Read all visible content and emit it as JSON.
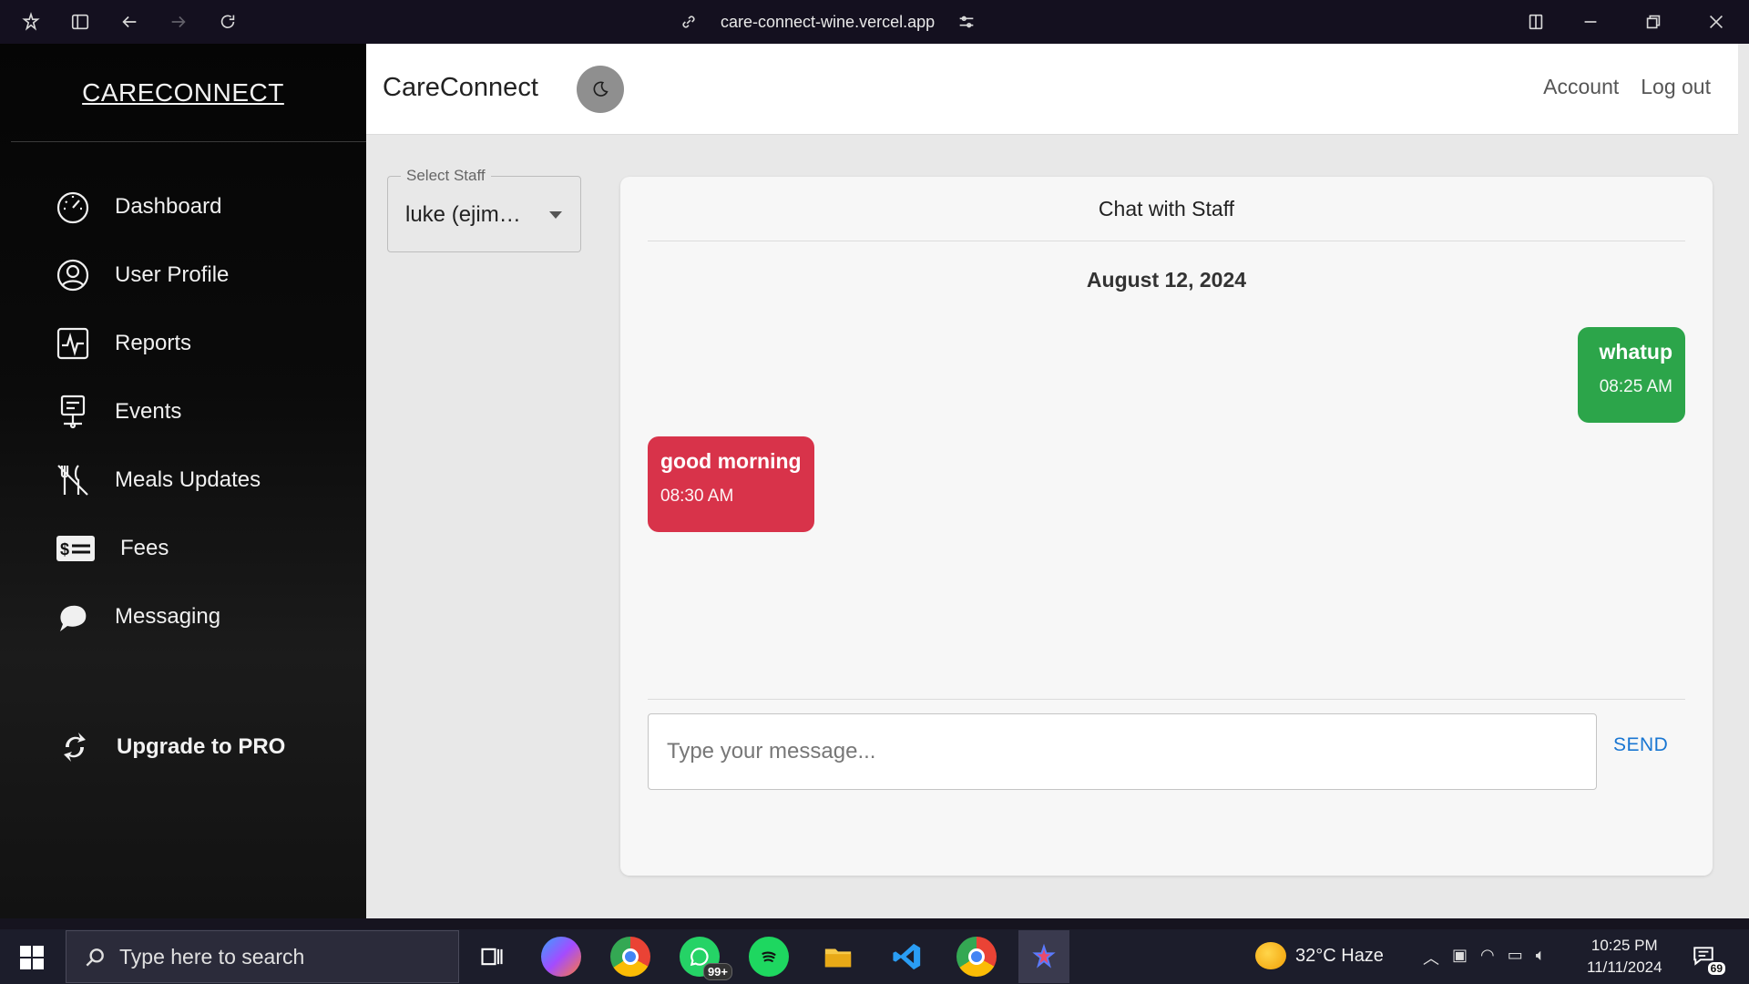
{
  "browser": {
    "url": "care-connect-wine.vercel.app"
  },
  "sidebar": {
    "brand": "CARECONNECT",
    "items": [
      {
        "label": "Dashboard",
        "icon": "dashboard-gauge-icon"
      },
      {
        "label": "User Profile",
        "icon": "user-circle-icon"
      },
      {
        "label": "Reports",
        "icon": "pulse-chart-icon"
      },
      {
        "label": "Events",
        "icon": "presentation-board-icon"
      },
      {
        "label": "Meals Updates",
        "icon": "no-meals-icon"
      },
      {
        "label": "Fees",
        "icon": "money-bill-icon"
      },
      {
        "label": "Messaging",
        "icon": "chat-bubbles-icon"
      }
    ],
    "upgrade": "Upgrade to PRO"
  },
  "header": {
    "title": "CareConnect",
    "account": "Account",
    "logout": "Log out"
  },
  "staff_select": {
    "label": "Select Staff",
    "value": "luke (ejim…"
  },
  "chat": {
    "title": "Chat with Staff",
    "date": "August 12, 2024",
    "messages": [
      {
        "text": "whatup",
        "time": "08:25 AM",
        "direction": "sent",
        "color": "#2ca54a"
      },
      {
        "text": "good morning",
        "time": "08:30 AM",
        "direction": "received",
        "color": "#d8334a"
      }
    ],
    "input_placeholder": "Type your message...",
    "send_label": "SEND"
  },
  "taskbar": {
    "search_placeholder": "Type here to search",
    "whatsapp_badge": "99+",
    "weather": "32°C  Haze",
    "time": "10:25 PM",
    "date": "11/11/2024",
    "notifications": "69"
  }
}
